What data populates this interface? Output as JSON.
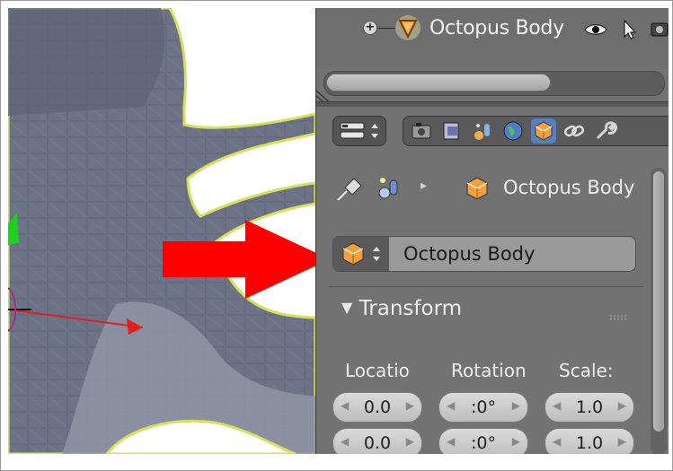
{
  "outliner": {
    "object_name": "Octopus Body",
    "expand_symbol": "+"
  },
  "properties": {
    "breadcrumb_object": "Octopus Body",
    "object_name_field": "Octopus Body",
    "transform_header": "Transform",
    "transform_arrow": "▼",
    "columns": {
      "location_label": "Locatio",
      "rotation_label": "Rotation",
      "scale_label": "Scale:"
    },
    "location_values": [
      "0.0",
      "0.0"
    ],
    "rotation_values": [
      ":0°",
      ":0°"
    ],
    "scale_values": [
      "1.0",
      "1.0"
    ]
  },
  "icons": {
    "expand": "plus-circle-icon",
    "mesh": "triangle-mesh-icon",
    "visibility": "eye-icon",
    "selectability": "cursor-arrow-icon",
    "renderability": "camera-icon",
    "editor_type": "editor-type-icon",
    "tabs": [
      "render-tab-icon",
      "layers-tab-icon",
      "scene-tab-icon",
      "world-tab-icon",
      "object-tab-icon",
      "constraints-tab-icon",
      "modifiers-tab-icon"
    ],
    "pin": "pin-icon",
    "scene_data": "scene-data-icon",
    "object": "object-cube-icon"
  },
  "colors": {
    "panel_bg": "#727272",
    "active_tab": "#5680c2",
    "selection_outline": "#d8e05a",
    "annotation_arrow": "#ff0000",
    "object_orange": "#f0a040"
  }
}
